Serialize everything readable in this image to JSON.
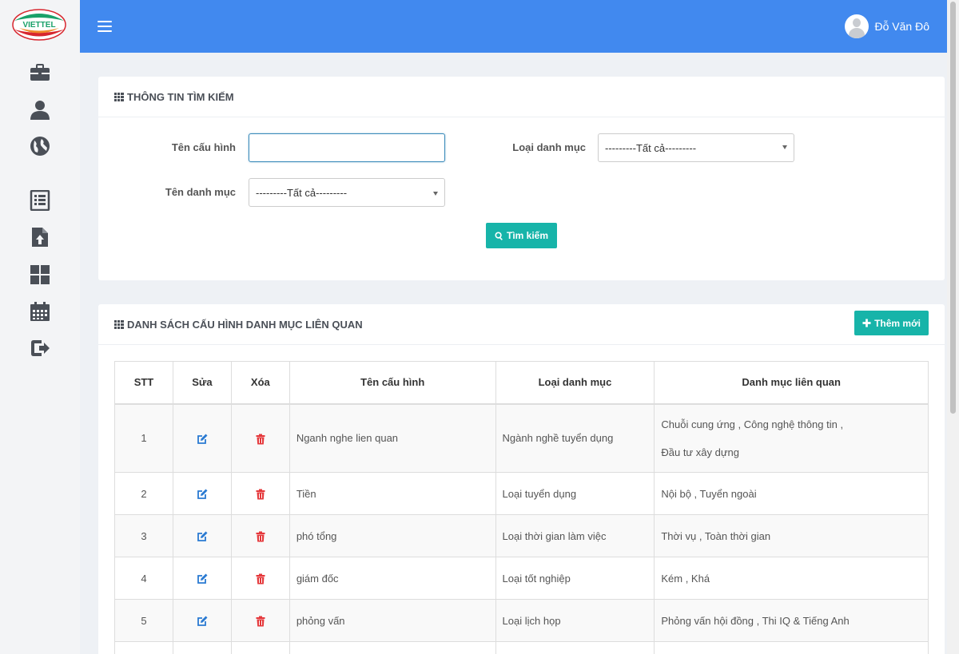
{
  "brand": {
    "logo_text": "VIETTEL"
  },
  "header": {
    "user_name": "Đỗ Văn Đô"
  },
  "sidebar": {
    "icons": [
      "briefcase-icon",
      "user-icon",
      "globe-icon",
      "list-icon",
      "file-upload-icon",
      "dashboard-icon",
      "calendar-icon",
      "logout-icon"
    ]
  },
  "search": {
    "title": "THÔNG TIN TÌM KIẾM",
    "config_name_label": "Tên cấu hình",
    "config_name_value": "",
    "category_type_label": "Loại danh mục",
    "category_type_value": "---------Tất cả---------",
    "category_name_label": "Tên danh mục",
    "category_name_value": "---------Tất cả---------",
    "search_button": "Tìm kiếm"
  },
  "list": {
    "title": "DANH SÁCH CẤU HÌNH DANH MỤC LIÊN QUAN",
    "add_button": "Thêm mới",
    "columns": [
      "STT",
      "Sửa",
      "Xóa",
      "Tên cấu hình",
      "Loại danh mục",
      "Danh mục liên quan"
    ],
    "rows": [
      {
        "stt": "1",
        "name": "Nganh nghe lien quan",
        "type": "Ngành nghề tuyển dụng",
        "related_line1": "Chuỗi cung ứng , Công nghệ thông tin ,",
        "related_line2": "Đầu tư xây dựng"
      },
      {
        "stt": "2",
        "name": "Tiền",
        "type": "Loại tuyển dụng",
        "related_line1": "Nội bộ , Tuyển ngoài",
        "related_line2": ""
      },
      {
        "stt": "3",
        "name": "phó tổng",
        "type": "Loại thời gian làm việc",
        "related_line1": "Thời vụ , Toàn thời gian",
        "related_line2": ""
      },
      {
        "stt": "4",
        "name": "giám đốc",
        "type": "Loại tốt nghiệp",
        "related_line1": "Kém , Khá",
        "related_line2": ""
      },
      {
        "stt": "5",
        "name": "phỏng vấn",
        "type": "Loại lịch họp",
        "related_line1": "Phỏng vấn hội đồng , Thi IQ & Tiếng Anh",
        "related_line2": ""
      }
    ]
  },
  "colors": {
    "topbar": "#4189ef",
    "accent_button": "#17b4a9",
    "edit_icon": "#2a7ad2",
    "delete_icon": "#e5383b"
  }
}
